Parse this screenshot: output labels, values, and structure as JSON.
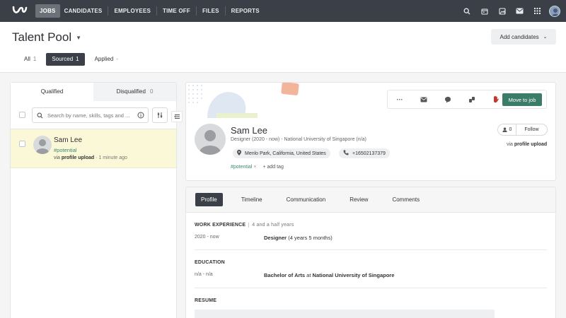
{
  "nav": {
    "items": [
      "JOBS",
      "CANDIDATES",
      "EMPLOYEES",
      "TIME OFF",
      "FILES",
      "REPORTS"
    ],
    "icons": [
      "search-icon",
      "calendar-icon",
      "image-icon",
      "mail-icon",
      "apps-grid-icon",
      "user-avatar"
    ]
  },
  "header": {
    "title": "Talent Pool",
    "add_candidates": "Add candidates",
    "tabs": [
      {
        "label": "All",
        "count": "1"
      },
      {
        "label": "Sourced",
        "count": "1"
      },
      {
        "label": "Applied",
        "count": "-"
      }
    ]
  },
  "left": {
    "tabs": [
      {
        "label": "Qualified",
        "count": ""
      },
      {
        "label": "Disqualified",
        "count": "0"
      }
    ],
    "search_placeholder": "Search by name, skills, tags and ...",
    "candidate": {
      "name": "Sam Lee",
      "tag": "#potential",
      "via_prefix": "via",
      "via_source": "profile upload",
      "sep": "·",
      "time": "1 minute ago"
    }
  },
  "profile": {
    "actions": {
      "more": "···",
      "move_to_job": "Move to job"
    },
    "name": "Sam Lee",
    "subtitle": "Designer (2020 - now) - National University of Singapore (n/a)",
    "location": "Menlo Park, California, United States",
    "phone": "+16502137379",
    "tag": "#potential",
    "tag_remove": "×",
    "add_tag": "+  add tag",
    "followers_count": "0",
    "follow_label": "Follow",
    "via_prefix": "via",
    "via_source": "profile upload"
  },
  "details": {
    "tabs": [
      "Profile",
      "Timeline",
      "Communication",
      "Review",
      "Comments"
    ],
    "work_title": "WORK EXPERIENCE",
    "work_note": "4 and a half years",
    "work_date": "2020 - now",
    "work_role": "Designer",
    "work_duration": "(4 years 5 months)",
    "edu_title": "EDUCATION",
    "edu_date": "n/a - n/a",
    "edu_degree": "Bachelor of Arts",
    "edu_at": "at",
    "edu_school": "National University of Singapore",
    "resume_title": "RESUME"
  },
  "colors": {
    "topbar": "#3b4048",
    "accent_green": "#3a7c67",
    "tag_green": "#3b8a6e",
    "highlight_row": "#fbf8d8"
  }
}
